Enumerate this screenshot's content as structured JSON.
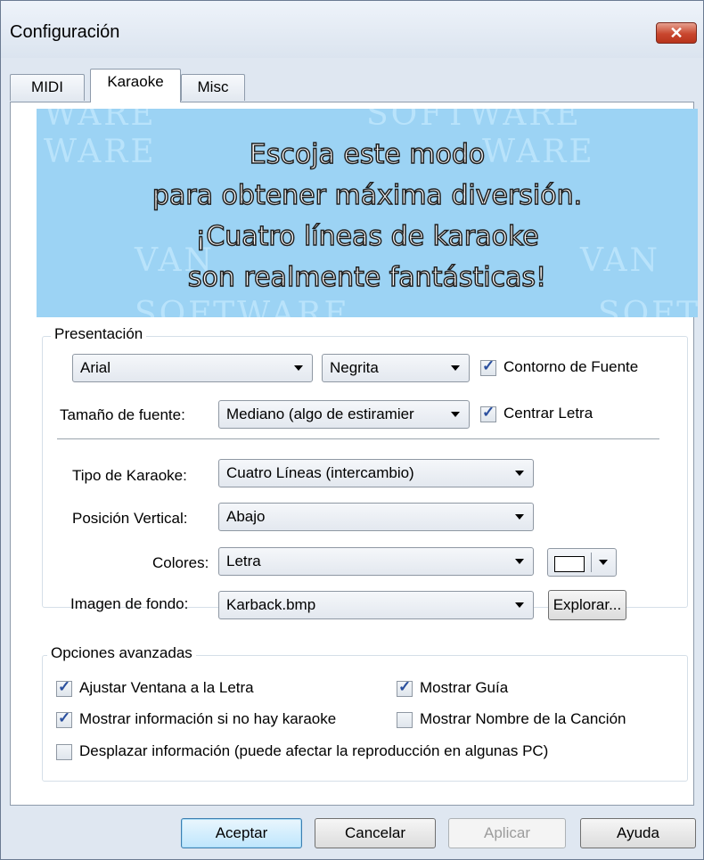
{
  "window": {
    "title": "Configuración",
    "close_icon": "✕"
  },
  "tabs": [
    {
      "label": "MIDI"
    },
    {
      "label": "Karaoke",
      "active": true
    },
    {
      "label": "Misc"
    }
  ],
  "banner": {
    "lines": [
      "Escoja este modo",
      "para obtener máxima diversión.",
      "¡Cuatro líneas de karaoke",
      "son realmente fantásticas!"
    ],
    "watermark": [
      "WARE",
      "SOFTWARE",
      "WARE",
      "VAN",
      "VAN",
      "SOFTWARE",
      "SOFT"
    ],
    "background": "#9cd3f4"
  },
  "presentation": {
    "legend": "Presentación",
    "font_combo": "Arial",
    "style_combo": "Negrita",
    "outline_check": {
      "label": "Contorno de Fuente",
      "checked": true
    },
    "size_label": "Tamaño de fuente:",
    "size_combo": "Mediano (algo de estiramier",
    "center_check": {
      "label": "Centrar Letra",
      "checked": true
    },
    "karaoke_type_label": "Tipo de Karaoke:",
    "karaoke_type_combo": "Cuatro Líneas (intercambio)",
    "vertical_label": "Posición Vertical:",
    "vertical_combo": "Abajo",
    "colors_label": "Colores:",
    "colors_combo": "Letra",
    "color_swatch": "#ffffff",
    "background_label": "Imagen de fondo:",
    "background_combo": "Karback.bmp",
    "browse_button": "Explorar..."
  },
  "advanced": {
    "legend": "Opciones avanzadas",
    "options": [
      {
        "label": "Ajustar Ventana a la Letra",
        "checked": true
      },
      {
        "label": "Mostrar Guía",
        "checked": true
      },
      {
        "label": "Mostrar información si no hay karaoke",
        "checked": true
      },
      {
        "label": "Mostrar Nombre de la Canción",
        "checked": false
      },
      {
        "label": "Desplazar información (puede afectar la reproducción en algunas PC)",
        "checked": false
      }
    ]
  },
  "buttons": {
    "ok": "Aceptar",
    "cancel": "Cancelar",
    "apply": "Aplicar",
    "help": "Ayuda"
  },
  "check_mark": "✓"
}
